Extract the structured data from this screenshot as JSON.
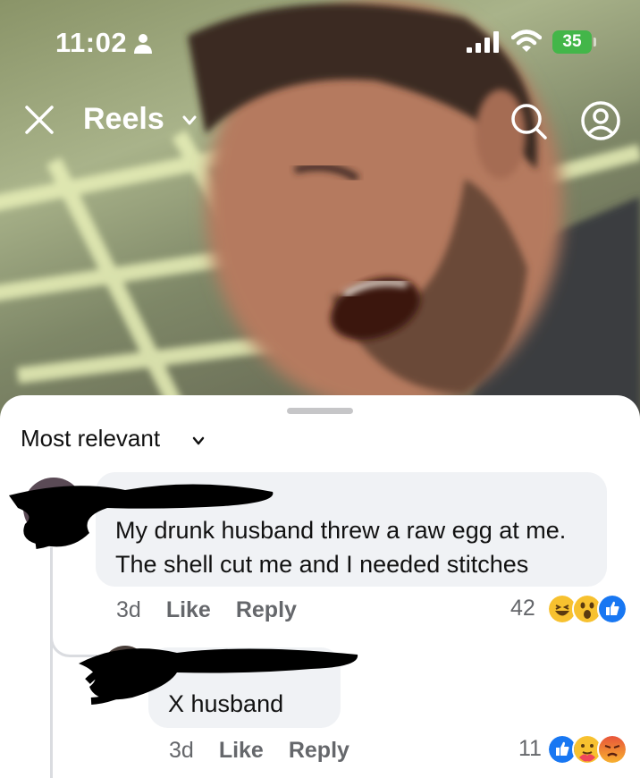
{
  "status_bar": {
    "time": "11:02",
    "battery": "35"
  },
  "header": {
    "title": "Reels"
  },
  "comments": {
    "sort_label": "Most relevant",
    "items": [
      {
        "text": "My drunk husband threw a raw egg at me.\nThe shell cut me and I needed stitches",
        "age": "3d",
        "like_label": "Like",
        "reply_label": "Reply",
        "reaction_count": "42",
        "reactions": [
          "haha-icon",
          "wow-icon",
          "like-icon"
        ]
      },
      {
        "text": "X husband",
        "age": "3d",
        "like_label": "Like",
        "reply_label": "Reply",
        "reaction_count": "11",
        "reactions": [
          "like-icon",
          "care-icon",
          "angry-icon"
        ]
      }
    ]
  },
  "colors": {
    "battery_green": "#43b649",
    "like_blue": "#1877f2",
    "bubble_gray": "#f0f2f5",
    "meta_gray": "#65676b"
  }
}
